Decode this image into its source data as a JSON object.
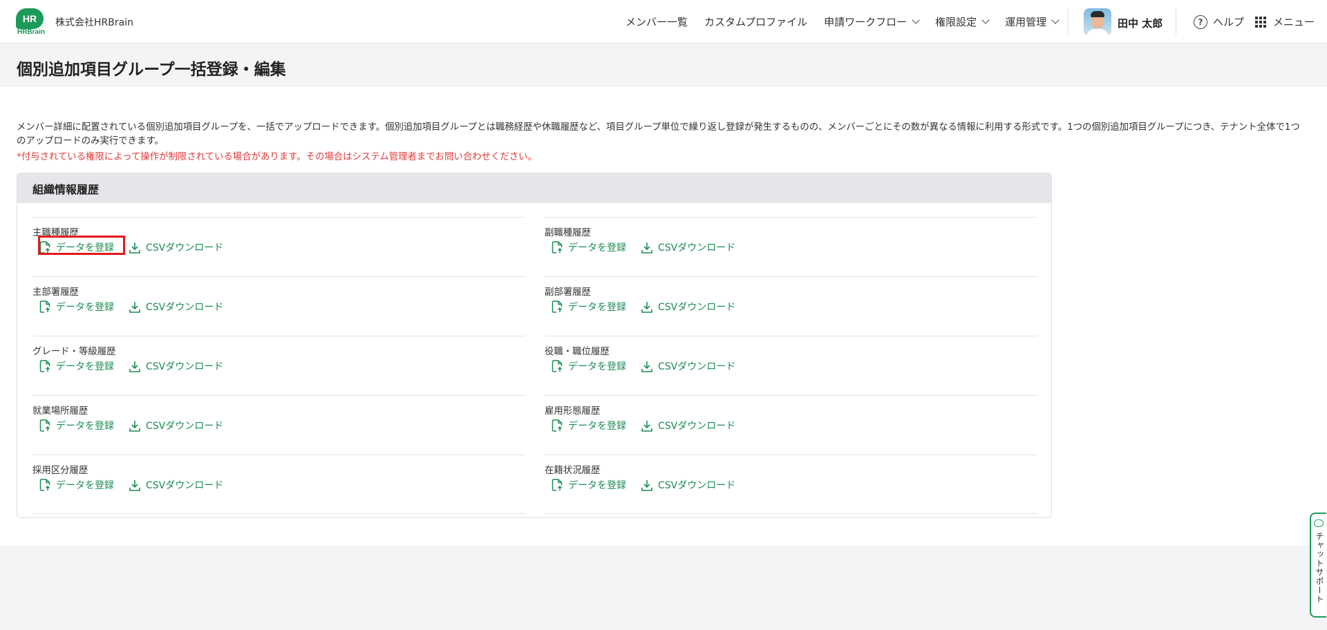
{
  "header": {
    "logo_mark": "HR",
    "logo_text": "HRBrain",
    "company": "株式会社HRBrain",
    "nav": [
      {
        "label": "メンバー一覧",
        "dropdown": false
      },
      {
        "label": "カスタムプロファイル",
        "dropdown": false
      },
      {
        "label": "申請ワークフロー",
        "dropdown": true
      },
      {
        "label": "権限設定",
        "dropdown": true
      },
      {
        "label": "運用管理",
        "dropdown": true
      }
    ],
    "user_name": "田中 太郎",
    "help_label": "ヘルプ",
    "menu_label": "メニュー"
  },
  "page": {
    "title": "個別追加項目グループ一括登録・編集",
    "description": "メンバー詳細に配置されている個別追加項目グループを、一括でアップロードできます。個別追加項目グループとは職務経歴や休職履歴など、項目グループ単位で繰り返し登録が発生するものの、メンバーごとにその数が異なる情報に利用する形式です。1つの個別追加項目グループにつき、テナント全体で1つのアップロードのみ実行できます。",
    "notice": "*付与されている権限によって操作が制限されている場合があります。その場合はシステム管理者までお問い合わせください。"
  },
  "card": {
    "title": "組織情報履歴",
    "register_label": "データを登録",
    "download_label": "CSVダウンロード",
    "left_items": [
      "主職種履歴",
      "主部署履歴",
      "グレード・等級履歴",
      "就業場所履歴",
      "採用区分履歴"
    ],
    "right_items": [
      "副職種履歴",
      "副部署履歴",
      "役職・職位履歴",
      "雇用形態履歴",
      "在籍状況履歴"
    ]
  },
  "chat": {
    "label": "チャットサポート"
  },
  "colors": {
    "accent": "#1a8c52",
    "notice": "#e03a3a",
    "highlight": "#e21a1a"
  }
}
